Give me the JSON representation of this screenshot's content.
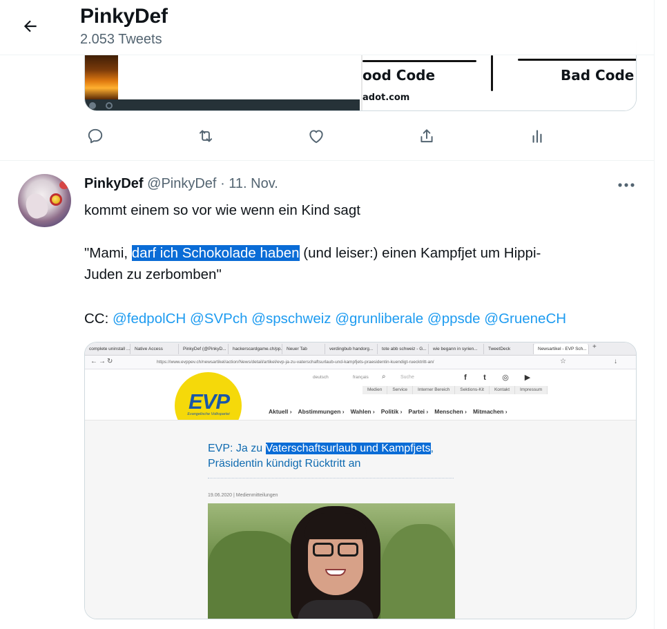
{
  "header": {
    "name": "PinkyDef",
    "tweet_count": "2.053 Tweets"
  },
  "prev_tweet": {
    "media": {
      "panel_left_label": "ood Code",
      "panel_right_label": "Bad Code",
      "site": "adot.com"
    }
  },
  "tweet": {
    "display_name": "PinkyDef",
    "handle": "@PinkyDef",
    "separator": "·",
    "date": "11. Nov.",
    "line1": "kommt einem so vor wie wenn ein Kind sagt",
    "line2_pre": "\"Mami, ",
    "line2_highlight": "darf ich Schokolade haben",
    "line2_post": " (und leiser:) einen Kampfjet um Hippi-",
    "line3": "Juden zu zerbomben\"",
    "cc_label": "CC: ",
    "mentions": [
      "@fedpolCH",
      "@SVPch",
      "@spschweiz",
      "@grunliberale",
      "@ppsde",
      "@GrueneCH"
    ]
  },
  "screenshot": {
    "tabs": [
      "complete uninstall ...",
      "Native Access",
      "PinkyDef (@PinkyD...",
      "hackerscardgame.ch/pp...",
      "Neuer Tab",
      "verdingbub handorg...",
      "tote abb schweiz - G...",
      "wie begann in syrien...",
      "TweetDeck",
      "Newsartikel - EVP Sch..."
    ],
    "url": "https://www.evppev.ch/newsartikel/action/News/detail/artikel/evp-ja-zu-vaterschaftsurlaub-und-kampfjets-praesidentin-kuendigt-ruecktritt-an/",
    "lang_de": "deutsch",
    "lang_fr": "français",
    "search_placeholder": "Suche",
    "subnav": [
      "Medien",
      "Service",
      "Interner Bereich",
      "Sektions-Kit",
      "Kontakt",
      "Impressum"
    ],
    "logo_text": "EVP",
    "logo_sub": "Evangelische Volkspartei",
    "mainnav": [
      "Aktuell ›",
      "Abstimmungen ›",
      "Wahlen ›",
      "Politik ›",
      "Partei ›",
      "Menschen ›",
      "Mitmachen ›"
    ],
    "title_pre": "EVP: Ja zu ",
    "title_highlight": "Vaterschaftsurlaub und Kampfjets",
    "title_post": ",",
    "title_line2": "Präsidentin kündigt Rücktritt an",
    "date": "19.06.2020",
    "category": "Medienmitteilungen"
  },
  "colors": {
    "accent": "#1d9bf0",
    "secondary_text": "#536471",
    "highlight": "#0a6cd6",
    "evp_yellow": "#f5d90a",
    "evp_blue": "#1a56a8"
  },
  "icons": {
    "back": "arrow-left-icon",
    "reply": "reply-icon",
    "retweet": "retweet-icon",
    "like": "heart-icon",
    "share": "share-icon",
    "analytics": "analytics-icon",
    "more": "more-dots-icon"
  }
}
